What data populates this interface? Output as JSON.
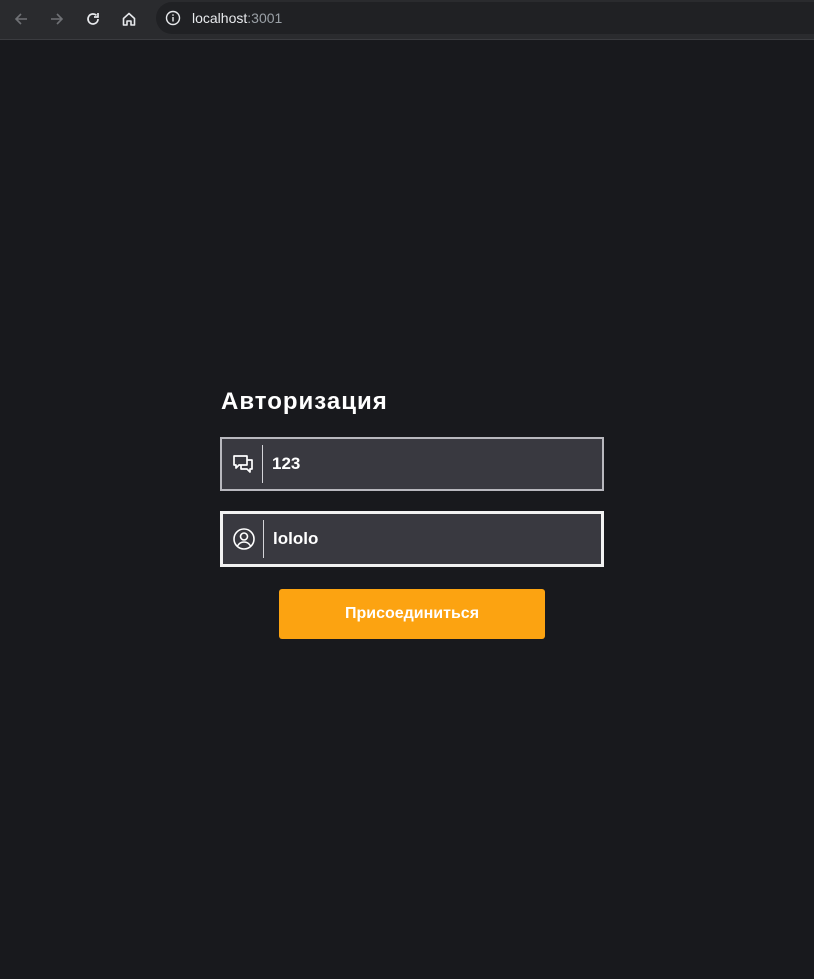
{
  "browser": {
    "url_host": "localhost",
    "url_port": ":3001",
    "icons": {
      "back": "arrow-left-icon",
      "forward": "arrow-right-icon",
      "reload": "reload-icon",
      "home": "home-icon",
      "info": "info-icon"
    }
  },
  "auth": {
    "title": "Авторизация",
    "room_field": {
      "value": "123",
      "icon": "chat-bubbles-icon"
    },
    "user_field": {
      "value": "lololo",
      "icon": "user-circle-icon"
    },
    "join_label": "Присоединиться"
  },
  "colors": {
    "background": "#18191d",
    "field_background": "#393940",
    "accent": "#fca311"
  }
}
